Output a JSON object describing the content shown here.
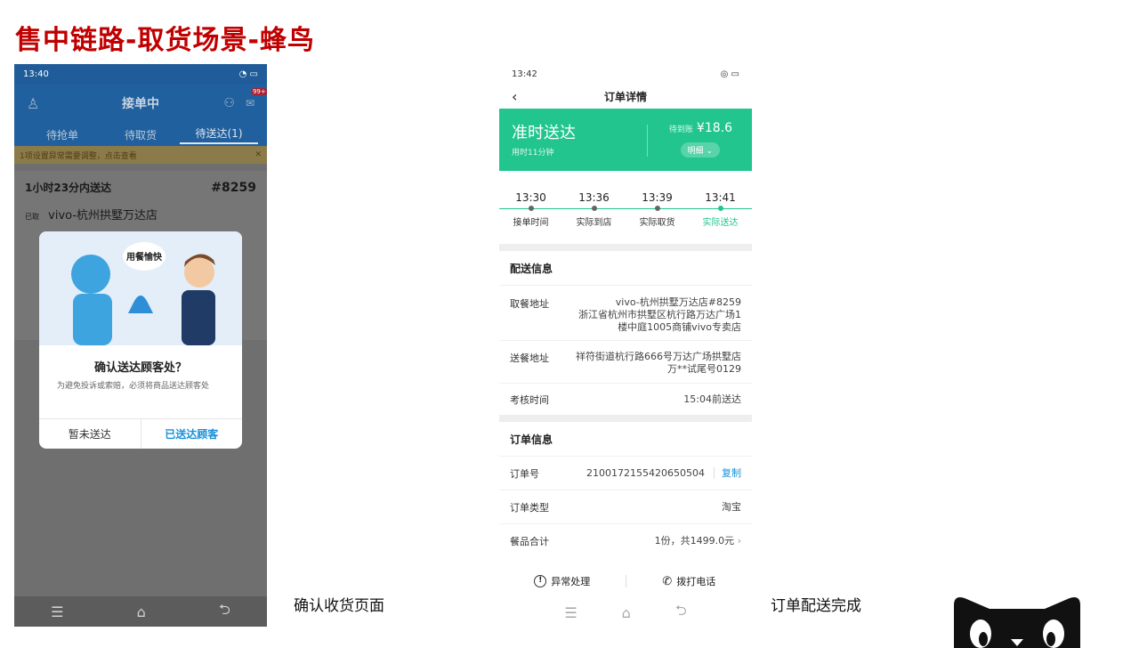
{
  "slide": {
    "title": "售中链路-取货场景-蜂鸟"
  },
  "phone1": {
    "status_time": "13:40",
    "header_title": "接单中",
    "badge": "99+",
    "tabs": [
      "待抢单",
      "待取货",
      "待送达(1)"
    ],
    "notice": "1项设置异常需要调整，点击查看",
    "order": {
      "deadline": "1小时23分内送达",
      "number": "#8259",
      "store_tag": "已取",
      "store": "vivo-杭州拱墅万达店"
    },
    "dialog": {
      "bubble": "用餐愉快",
      "title": "确认送达顾客处？",
      "desc": "为避免投诉或索赔，必须将商品送达顾客处",
      "cancel": "暂未送达",
      "confirm": "已送达顾客"
    }
  },
  "caption_left": "确认收货页面",
  "caption_right": "订单配送完成",
  "phone2": {
    "status_time": "13:42",
    "nav_title": "订单详情",
    "banner": {
      "status": "准时送达",
      "used_time": "用时11分钟",
      "pending_label": "待到账",
      "amount": "¥18.6",
      "detail_btn": "明细"
    },
    "timeline": [
      {
        "time": "13:30",
        "label": "接单时间"
      },
      {
        "time": "13:36",
        "label": "实际到店"
      },
      {
        "time": "13:39",
        "label": "实际取货"
      },
      {
        "time": "13:41",
        "label": "实际送达"
      }
    ],
    "delivery": {
      "title": "配送信息",
      "pickup_label": "取餐地址",
      "pickup_line1": "vivo-杭州拱墅万达店#8259",
      "pickup_line2": "浙江省杭州市拱墅区杭行路万达广场1",
      "pickup_line3": "楼中庭1005商铺vivo专卖店",
      "dropoff_label": "送餐地址",
      "dropoff_line1": "祥符街道杭行路666号万达广场拱墅店",
      "dropoff_line2": "万**试尾号0129",
      "check_label": "考核时间",
      "check_value": "15:04前送达"
    },
    "order": {
      "title": "订单信息",
      "no_label": "订单号",
      "no_value": "2100172155420650504",
      "copy": "复制",
      "type_label": "订单类型",
      "type_value": "淘宝",
      "total_label": "餐品合计",
      "total_value": "1份，共1499.0元"
    },
    "actions": {
      "exception": "异常处理",
      "call": "拨打电话"
    }
  },
  "colors": {
    "accent_green": "#22c58d",
    "title_red": "#c00000",
    "link_blue": "#1890d8"
  }
}
